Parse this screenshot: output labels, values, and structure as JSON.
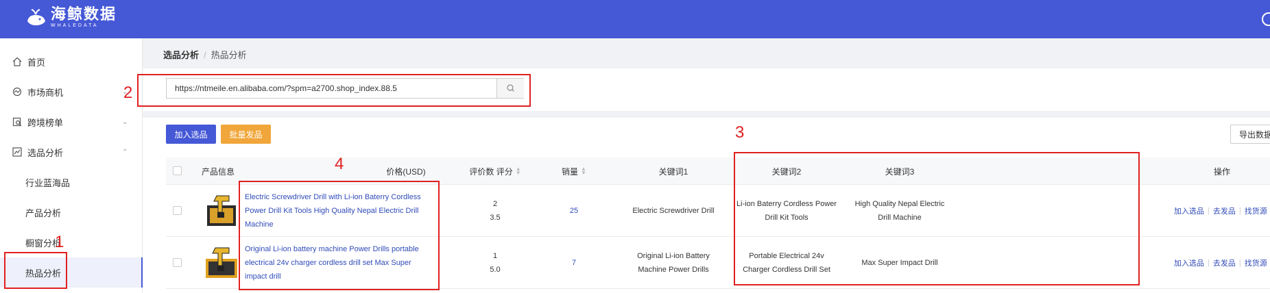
{
  "app": {
    "logo_cn": "海鲸数据",
    "logo_en": "WHALEDATA",
    "brand_color": "#4558d6"
  },
  "sidebar": {
    "items": [
      {
        "label": "首页",
        "icon": "home-icon"
      },
      {
        "label": "市场商机",
        "icon": "market-icon",
        "chevron": "down"
      },
      {
        "label": "跨境榜单",
        "icon": "ranking-icon",
        "chevron": "down"
      },
      {
        "label": "选品分析",
        "icon": "chart-icon",
        "chevron": "up"
      }
    ],
    "sub_items": [
      {
        "label": "行业蓝海品"
      },
      {
        "label": "产品分析"
      },
      {
        "label": "橱窗分析"
      },
      {
        "label": "热品分析",
        "active": true
      }
    ]
  },
  "breadcrumb": {
    "parent": "选品分析",
    "separator": "/",
    "current": "热品分析"
  },
  "search": {
    "value": "https://ntmeile.en.alibaba.com/?spm=a2700.shop_index.88.5",
    "icon": "search-icon"
  },
  "toolbar": {
    "add_label": "加入选品",
    "batch_label": "批量发品",
    "export_label": "导出数据"
  },
  "table": {
    "headers": {
      "product": "产品信息",
      "price": "价格(USD)",
      "reviews": "评价数 评分",
      "sales": "销量",
      "kw1": "关键词1",
      "kw2": "关键词2",
      "kw3": "关键词3",
      "actions": "操作"
    },
    "rows": [
      {
        "title": "Electric Screwdriver Drill with Li-ion Baterry Cordless Power Drill Kit Tools High Quality Nepal Electric Drill Machine",
        "price": "",
        "review_count": "2",
        "rating": "3.5",
        "sales": "25",
        "kw1": "Electric Screwdriver Drill",
        "kw2": "Li-ion Baterry Cordless Power Drill Kit Tools",
        "kw3": "High Quality Nepal Electric Drill Machine",
        "op_add": "加入选品",
        "op_publish": "去发品",
        "op_source": "找货源"
      },
      {
        "title": "Original Li-ion battery machine Power Drills portable electrical 24v charger cordless drill set Max Super impact drill",
        "price": "",
        "review_count": "1",
        "rating": "5.0",
        "sales": "7",
        "kw1": "Original Li-ion Battery Machine Power Drills",
        "kw2": "Portable Electrical 24v Charger Cordless Drill Set",
        "kw3": "Max Super Impact Drill",
        "op_add": "加入选品",
        "op_publish": "去发品",
        "op_source": "找货源"
      }
    ]
  },
  "annotations": {
    "n1": "1",
    "n2": "2",
    "n3": "3",
    "n4": "4",
    "color": "#e02020"
  }
}
